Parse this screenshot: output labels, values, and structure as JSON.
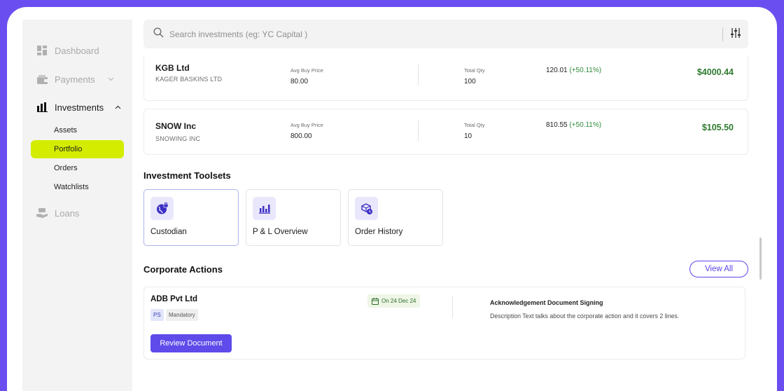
{
  "sidebar": {
    "items": [
      {
        "label": "Dashboard",
        "icon": "dashboard-icon"
      },
      {
        "label": "Payments",
        "icon": "wallet-icon"
      },
      {
        "label": "Investments",
        "icon": "bar-chart-icon"
      },
      {
        "label": "Loans",
        "icon": "hand-money-icon"
      }
    ],
    "subitems": [
      "Assets",
      "Portfolio",
      "Orders",
      "Watchlists"
    ],
    "active_subitem": "Portfolio"
  },
  "search": {
    "placeholder": "Search investments (eg: YC Capital )"
  },
  "holdings": [
    {
      "name": "KGB Ltd",
      "full_name": "KAGER BASKINS LTD",
      "avg_label": "Avg Buy Price",
      "avg_value": "80.00",
      "qty_label": "Total Qty",
      "qty_value": "100",
      "ltp": "120.01",
      "change": "(+50.11%)",
      "total": "$4000.44"
    },
    {
      "name": "SNOW Inc",
      "full_name": "SNOWING INC",
      "avg_label": "Avg Buy Price",
      "avg_value": "800.00",
      "qty_label": "Total Qty",
      "qty_value": "10",
      "ltp": "810.55",
      "change": "(+50.11%)",
      "total": "$105.50"
    }
  ],
  "toolsets": {
    "title": "Investment Toolsets",
    "items": [
      {
        "label": "Custodian",
        "icon": "globe-lock-icon"
      },
      {
        "label": "P & L Overview",
        "icon": "bar-chart-icon"
      },
      {
        "label": "Order History",
        "icon": "box-clock-icon"
      }
    ]
  },
  "corporate_actions": {
    "title": "Corporate Actions",
    "view_all": "View All",
    "items": [
      {
        "company": "ADB Pvt Ltd",
        "tag_short": "PS",
        "tag_type": "Mandatory",
        "date": "On 24 Dec 24",
        "action_title": "Acknowledgement Document Signing",
        "description": "Description Text talks about the  corporate action and it covers 2 lines.",
        "button": "Review Document"
      }
    ]
  },
  "colors": {
    "frame": "#6b4ef0",
    "accent": "#5f4bea",
    "active_nav": "#d4ec00",
    "positive": "#2f7a2f"
  }
}
